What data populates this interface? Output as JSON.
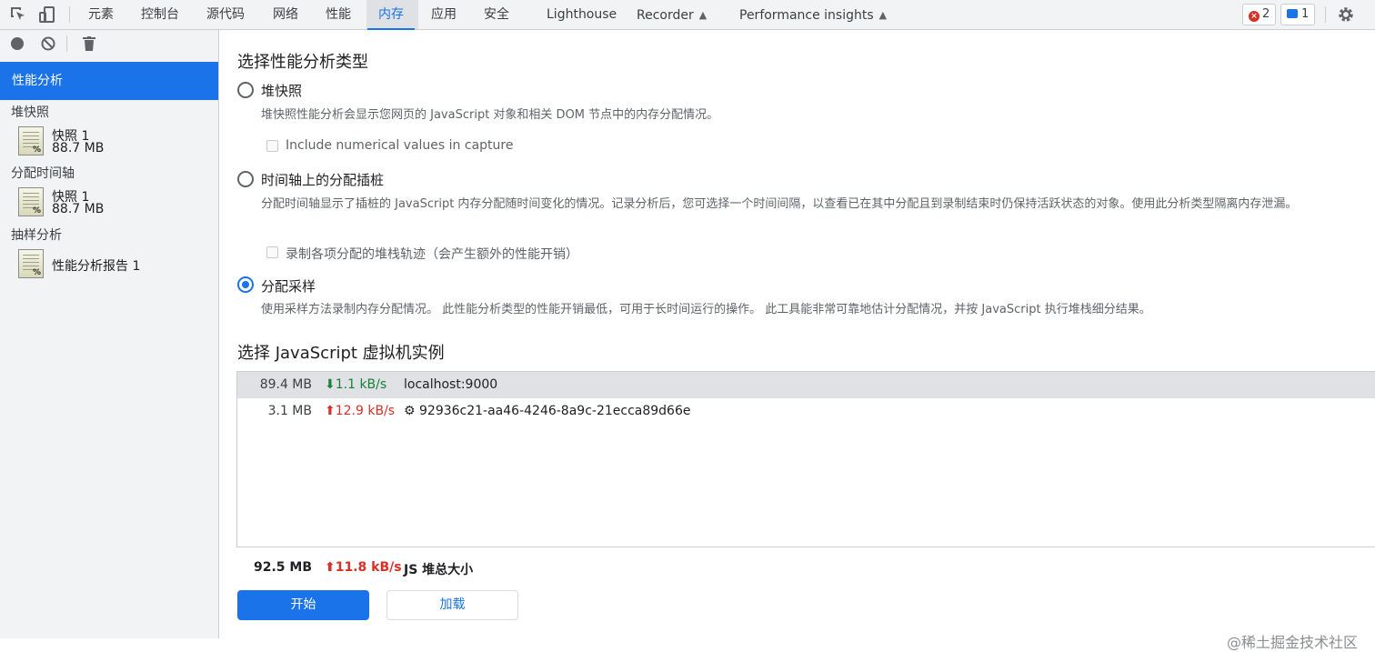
{
  "toolbar": {
    "tabs": [
      "元素",
      "控制台",
      "源代码",
      "网络",
      "性能",
      "内存",
      "应用",
      "安全",
      "Lighthouse",
      "Recorder",
      "Performance insights"
    ],
    "active_tab": "内存",
    "error_count": "2",
    "message_count": "1"
  },
  "sidebar": {
    "active_item": "性能分析",
    "groups": [
      {
        "title": "堆快照",
        "items": [
          {
            "name": "快照 1",
            "size": "88.7 MB"
          }
        ]
      },
      {
        "title": "分配时间轴",
        "items": [
          {
            "name": "快照 1",
            "size": "88.7 MB"
          }
        ]
      },
      {
        "title": "抽样分析",
        "items": [
          {
            "name": "性能分析报告 1"
          }
        ]
      }
    ]
  },
  "main": {
    "title": "选择性能分析类型",
    "options": [
      {
        "label": "堆快照",
        "desc": "堆快照性能分析会显示您网页的 JavaScript 对象和相关 DOM 节点中的内存分配情况。",
        "checkbox": "Include numerical values in capture",
        "selected": false
      },
      {
        "label": "时间轴上的分配插桩",
        "desc": "分配时间轴显示了插桩的 JavaScript 内存分配随时间变化的情况。记录分析后，您可选择一个时间间隔，以查看已在其中分配且到录制结束时仍保持活跃状态的对象。使用此分析类型隔离内存泄漏。",
        "checkbox": "录制各项分配的堆栈轨迹（会产生额外的性能开销）",
        "selected": false
      },
      {
        "label": "分配采样",
        "desc": "使用采样方法录制内存分配情况。 此性能分析类型的性能开销最低，可用于长时间运行的操作。 此工具能非常可靠地估计分配情况，并按 JavaScript 执行堆栈细分结果。",
        "selected": true
      }
    ],
    "vm_title": "选择 JavaScript 虚拟机实例",
    "vm_rows": [
      {
        "size": "89.4 MB",
        "rate": "⬇1.1 kB/s",
        "name": "localhost:9000"
      },
      {
        "size": "3.1 MB",
        "rate": "⬆12.9 kB/s",
        "name": "⚙ 92936c21-aa46-4246-8a9c-21ecca89d66e"
      }
    ],
    "total": {
      "size": "92.5 MB",
      "rate": "⬆11.8 kB/s",
      "label": "JS 堆总大小"
    },
    "start_button": "开始",
    "load_button": "加载"
  },
  "watermark": "@稀土掘金技术社区",
  "colors": {
    "accent": "#1a73e8",
    "up": "#d93025",
    "down": "#188038"
  }
}
